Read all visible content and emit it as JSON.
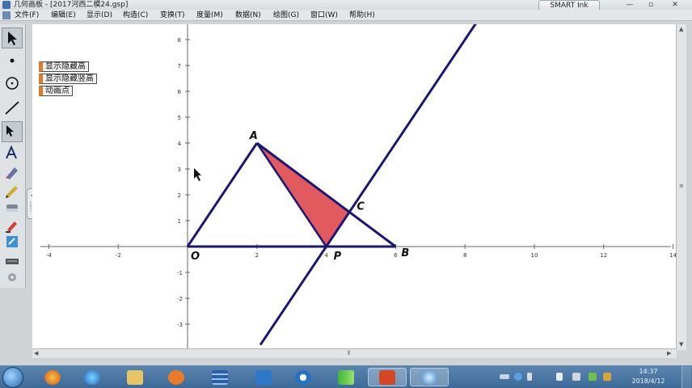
{
  "window": {
    "title": "几何画板 - [2017河西二模24.gsp]",
    "smart_ink": "SMART Ink",
    "min": "—",
    "max": "▫",
    "close": "✕"
  },
  "menu": [
    "文件(F)",
    "编辑(E)",
    "显示(D)",
    "构造(C)",
    "变换(T)",
    "度量(M)",
    "数据(N)",
    "绘图(G)",
    "窗口(W)",
    "帮助(H)"
  ],
  "buttons": {
    "show_hide_altitude": "显示隐藏高",
    "show_hide_vertical_altitude": "显示隐藏竖高",
    "animate_point": "动画点"
  },
  "side_tab": "◂◂",
  "axes": {
    "x_ticks": [
      "-4",
      "-2",
      "2",
      "4",
      "6",
      "8",
      "10",
      "12",
      "14"
    ],
    "y_ticks_pos": [
      "8",
      "7",
      "6",
      "5",
      "4",
      "3",
      "2",
      "1"
    ],
    "y_ticks_neg": [
      "-1",
      "-2",
      "-3"
    ]
  },
  "labels": {
    "origin": "O",
    "a": "A",
    "b": "B",
    "c": "C",
    "p": "P"
  },
  "geometry_data": {
    "O": [
      0,
      0
    ],
    "A": [
      2,
      4
    ],
    "B": [
      6,
      0
    ],
    "P": [
      4,
      0
    ],
    "C": [
      4.67,
      1.33
    ],
    "shaded_triangle": [
      "A",
      "P",
      "C"
    ],
    "line_through": [
      [
        4,
        0
      ],
      [
        8.4,
        8.8
      ]
    ]
  },
  "taskbar": {
    "apps": [
      "ie-icon",
      "explorer-icon",
      "media-icon",
      "app-grid-icon",
      "network-icon",
      "sogou-icon",
      "player-icon",
      "powerpoint-icon",
      "geometry-sketchpad-icon"
    ],
    "time": "14:37",
    "date": "2018/4/12"
  },
  "colors": {
    "line": "#1b1577",
    "fill": "#e05a5e",
    "button_accent": "#e07a27"
  }
}
